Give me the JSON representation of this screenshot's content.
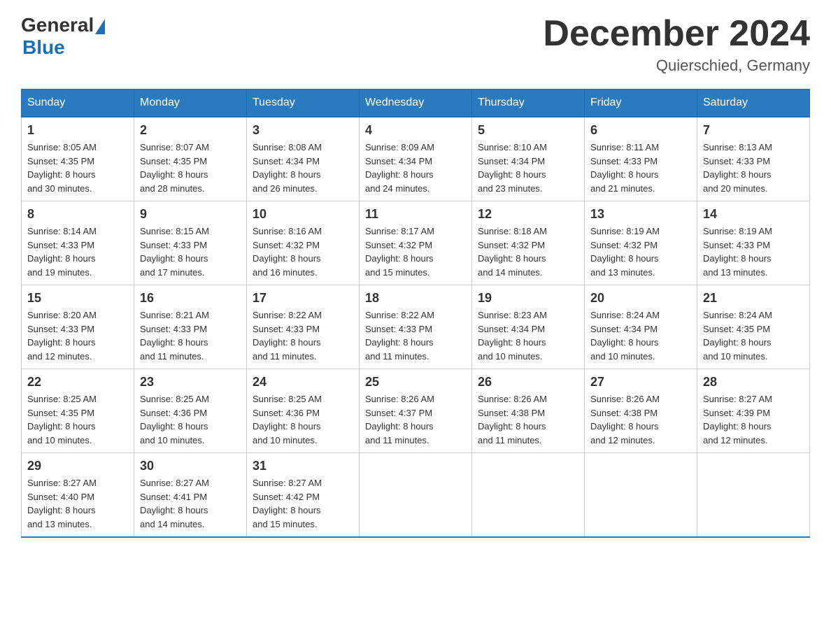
{
  "logo": {
    "general": "General",
    "blue": "Blue"
  },
  "title": "December 2024",
  "location": "Quierschied, Germany",
  "days_of_week": [
    "Sunday",
    "Monday",
    "Tuesday",
    "Wednesday",
    "Thursday",
    "Friday",
    "Saturday"
  ],
  "weeks": [
    [
      {
        "day": "1",
        "sunrise": "8:05 AM",
        "sunset": "4:35 PM",
        "daylight": "8 hours and 30 minutes."
      },
      {
        "day": "2",
        "sunrise": "8:07 AM",
        "sunset": "4:35 PM",
        "daylight": "8 hours and 28 minutes."
      },
      {
        "day": "3",
        "sunrise": "8:08 AM",
        "sunset": "4:34 PM",
        "daylight": "8 hours and 26 minutes."
      },
      {
        "day": "4",
        "sunrise": "8:09 AM",
        "sunset": "4:34 PM",
        "daylight": "8 hours and 24 minutes."
      },
      {
        "day": "5",
        "sunrise": "8:10 AM",
        "sunset": "4:34 PM",
        "daylight": "8 hours and 23 minutes."
      },
      {
        "day": "6",
        "sunrise": "8:11 AM",
        "sunset": "4:33 PM",
        "daylight": "8 hours and 21 minutes."
      },
      {
        "day": "7",
        "sunrise": "8:13 AM",
        "sunset": "4:33 PM",
        "daylight": "8 hours and 20 minutes."
      }
    ],
    [
      {
        "day": "8",
        "sunrise": "8:14 AM",
        "sunset": "4:33 PM",
        "daylight": "8 hours and 19 minutes."
      },
      {
        "day": "9",
        "sunrise": "8:15 AM",
        "sunset": "4:33 PM",
        "daylight": "8 hours and 17 minutes."
      },
      {
        "day": "10",
        "sunrise": "8:16 AM",
        "sunset": "4:32 PM",
        "daylight": "8 hours and 16 minutes."
      },
      {
        "day": "11",
        "sunrise": "8:17 AM",
        "sunset": "4:32 PM",
        "daylight": "8 hours and 15 minutes."
      },
      {
        "day": "12",
        "sunrise": "8:18 AM",
        "sunset": "4:32 PM",
        "daylight": "8 hours and 14 minutes."
      },
      {
        "day": "13",
        "sunrise": "8:19 AM",
        "sunset": "4:32 PM",
        "daylight": "8 hours and 13 minutes."
      },
      {
        "day": "14",
        "sunrise": "8:19 AM",
        "sunset": "4:33 PM",
        "daylight": "8 hours and 13 minutes."
      }
    ],
    [
      {
        "day": "15",
        "sunrise": "8:20 AM",
        "sunset": "4:33 PM",
        "daylight": "8 hours and 12 minutes."
      },
      {
        "day": "16",
        "sunrise": "8:21 AM",
        "sunset": "4:33 PM",
        "daylight": "8 hours and 11 minutes."
      },
      {
        "day": "17",
        "sunrise": "8:22 AM",
        "sunset": "4:33 PM",
        "daylight": "8 hours and 11 minutes."
      },
      {
        "day": "18",
        "sunrise": "8:22 AM",
        "sunset": "4:33 PM",
        "daylight": "8 hours and 11 minutes."
      },
      {
        "day": "19",
        "sunrise": "8:23 AM",
        "sunset": "4:34 PM",
        "daylight": "8 hours and 10 minutes."
      },
      {
        "day": "20",
        "sunrise": "8:24 AM",
        "sunset": "4:34 PM",
        "daylight": "8 hours and 10 minutes."
      },
      {
        "day": "21",
        "sunrise": "8:24 AM",
        "sunset": "4:35 PM",
        "daylight": "8 hours and 10 minutes."
      }
    ],
    [
      {
        "day": "22",
        "sunrise": "8:25 AM",
        "sunset": "4:35 PM",
        "daylight": "8 hours and 10 minutes."
      },
      {
        "day": "23",
        "sunrise": "8:25 AM",
        "sunset": "4:36 PM",
        "daylight": "8 hours and 10 minutes."
      },
      {
        "day": "24",
        "sunrise": "8:25 AM",
        "sunset": "4:36 PM",
        "daylight": "8 hours and 10 minutes."
      },
      {
        "day": "25",
        "sunrise": "8:26 AM",
        "sunset": "4:37 PM",
        "daylight": "8 hours and 11 minutes."
      },
      {
        "day": "26",
        "sunrise": "8:26 AM",
        "sunset": "4:38 PM",
        "daylight": "8 hours and 11 minutes."
      },
      {
        "day": "27",
        "sunrise": "8:26 AM",
        "sunset": "4:38 PM",
        "daylight": "8 hours and 12 minutes."
      },
      {
        "day": "28",
        "sunrise": "8:27 AM",
        "sunset": "4:39 PM",
        "daylight": "8 hours and 12 minutes."
      }
    ],
    [
      {
        "day": "29",
        "sunrise": "8:27 AM",
        "sunset": "4:40 PM",
        "daylight": "8 hours and 13 minutes."
      },
      {
        "day": "30",
        "sunrise": "8:27 AM",
        "sunset": "4:41 PM",
        "daylight": "8 hours and 14 minutes."
      },
      {
        "day": "31",
        "sunrise": "8:27 AM",
        "sunset": "4:42 PM",
        "daylight": "8 hours and 15 minutes."
      },
      null,
      null,
      null,
      null
    ]
  ]
}
